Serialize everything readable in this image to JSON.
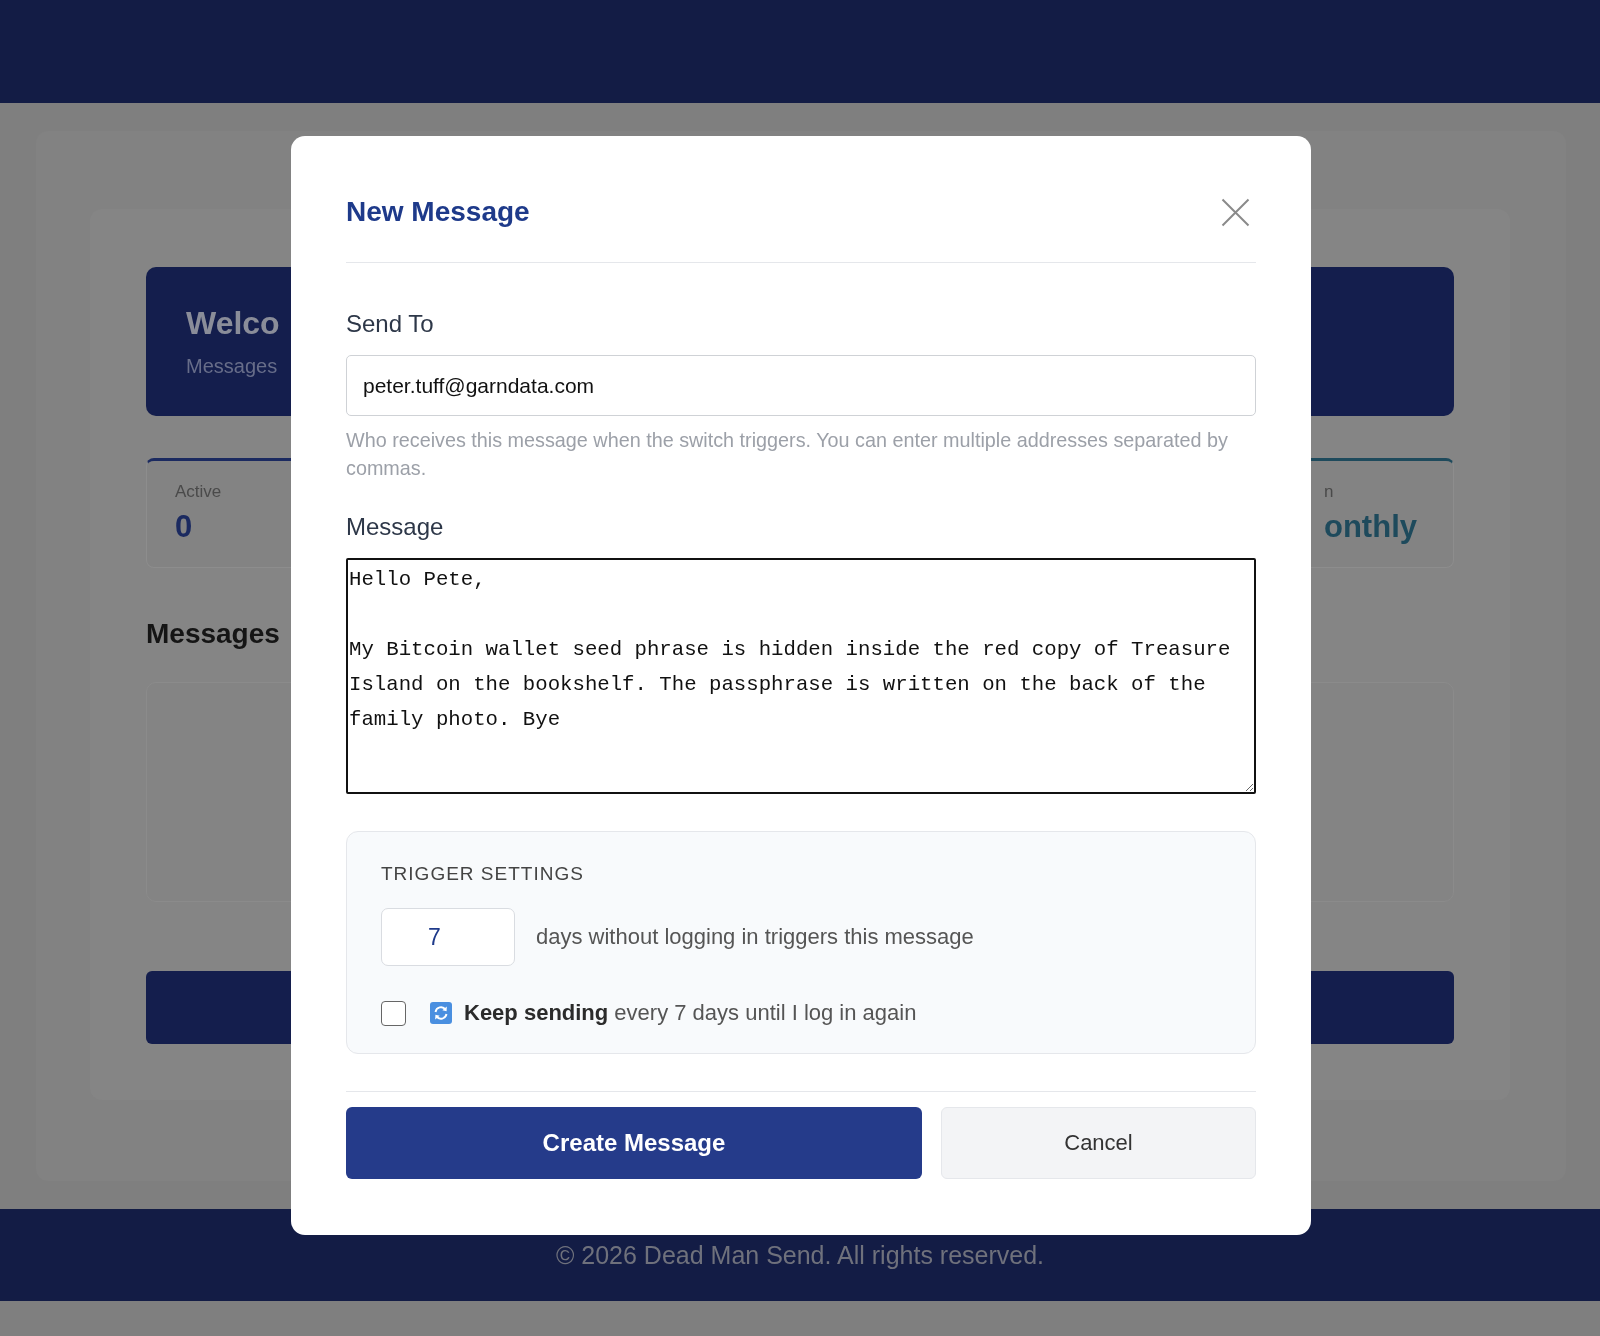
{
  "background": {
    "welcome": {
      "title": "Welco",
      "subtitle": "Messages"
    },
    "stats": [
      {
        "label": "Active",
        "value": "0",
        "color": "#1b2a60"
      },
      {
        "label": "n",
        "value": "onthly",
        "color": "#1e4a5c"
      }
    ],
    "messages_heading": "Messages"
  },
  "modal": {
    "title": "New Message",
    "fields": [
      {
        "kind": "input",
        "label": "Send To",
        "value": "peter.tuff@garndata.com",
        "focused": false,
        "hint": "Who receives this message when the switch triggers. You can enter multiple addresses separated by commas."
      },
      {
        "kind": "textarea",
        "label": "Message",
        "value": "Hello Pete,\n\nMy Bitcoin wallet seed phrase is hidden inside the red copy of Treasure Island on the bookshelf. The passphrase is written on the back of the family photo. Bye",
        "focused": true
      }
    ],
    "trigger_settings": {
      "title": "TRIGGER SETTINGS",
      "days": "7",
      "days_text": "days without logging in triggers this message",
      "repeat": {
        "checked": false,
        "text": "**Keep sending** every 7 days until I log in again"
      }
    },
    "buttons": [
      {
        "kind": "primary",
        "label": "Create Message"
      },
      {
        "kind": "secondary",
        "label": "Cancel"
      }
    ]
  },
  "footer": {
    "text": "© 2026 Dead Man Send. All rights reserved."
  }
}
